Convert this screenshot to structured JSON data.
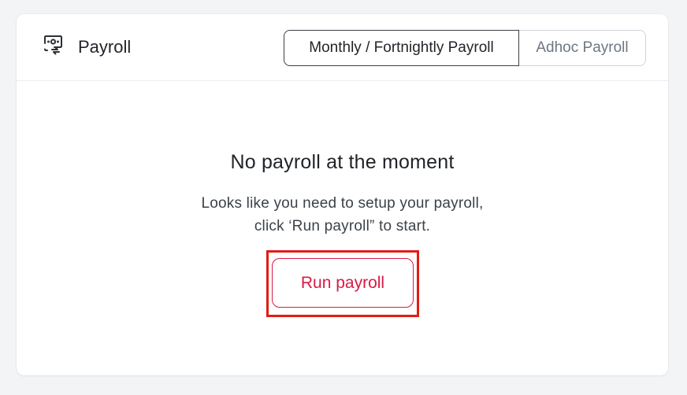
{
  "header": {
    "icon": "payroll-money-icon",
    "title": "Payroll"
  },
  "tabs": [
    {
      "label": "Monthly / Fortnightly Payroll",
      "active": true
    },
    {
      "label": "Adhoc Payroll",
      "active": false
    }
  ],
  "empty_state": {
    "title": "No payroll at the moment",
    "description_line1": "Looks like you need to setup your payroll,",
    "description_line2": "click ‘Run payroll” to start.",
    "button_label": "Run payroll"
  },
  "colors": {
    "accent": "#d81b45",
    "highlight": "#e31b12",
    "text_primary": "#1f2328",
    "text_muted": "#6c7781"
  }
}
